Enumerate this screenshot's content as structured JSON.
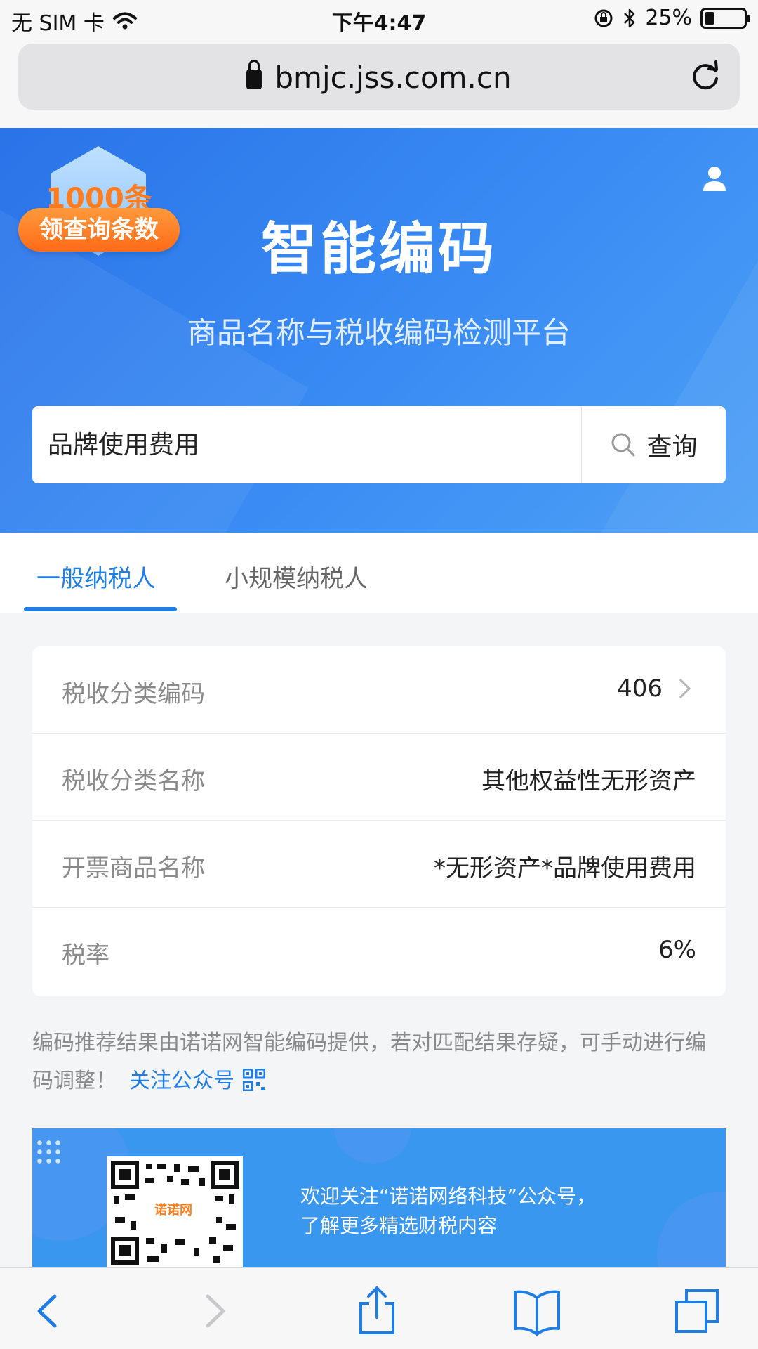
{
  "status_bar": {
    "carrier": "无 SIM 卡",
    "time": "下午4:47",
    "battery": "25%",
    "battery_level": 0.25
  },
  "browser": {
    "url": "bmjc.jss.com.cn"
  },
  "hero": {
    "badge_count": "1000条",
    "badge_label": "领查询条数",
    "title": "智能编码",
    "subtitle": "商品名称与税收编码检测平台"
  },
  "search": {
    "value": "品牌使用费用",
    "button_label": "查询"
  },
  "tabs": [
    {
      "label": "一般纳税人",
      "active": true
    },
    {
      "label": "小规模纳税人",
      "active": false
    }
  ],
  "result": {
    "rows": [
      {
        "label": "税收分类编码",
        "value": "406"
      },
      {
        "label": "税收分类名称",
        "value": "其他权益性无形资产"
      },
      {
        "label": "开票商品名称",
        "value": "*无形资产*品牌使用费用"
      },
      {
        "label": "税率",
        "value": "6%"
      }
    ]
  },
  "note": {
    "text": "编码推荐结果由诺诺网智能编码提供，若对匹配结果存疑，可手动进行编码调整！",
    "link": "关注公众号"
  },
  "banner": {
    "qr_label": "诺诺网",
    "line1": "欢迎关注“诺诺网络科技”公众号，",
    "line2": "了解更多精选财税内容"
  },
  "colors": {
    "accent": "#1f7de6",
    "hero_blue": "#2a73e8",
    "badge_orange": "#ff7d1f"
  },
  "icons": [
    "wifi-icon",
    "orientation-lock-icon",
    "bluetooth-icon",
    "lock-icon",
    "reload-icon",
    "user-icon",
    "search-icon",
    "chevron-right-icon",
    "qr-code-icon",
    "back-icon",
    "forward-icon",
    "share-icon",
    "bookmarks-icon",
    "tabs-icon"
  ]
}
